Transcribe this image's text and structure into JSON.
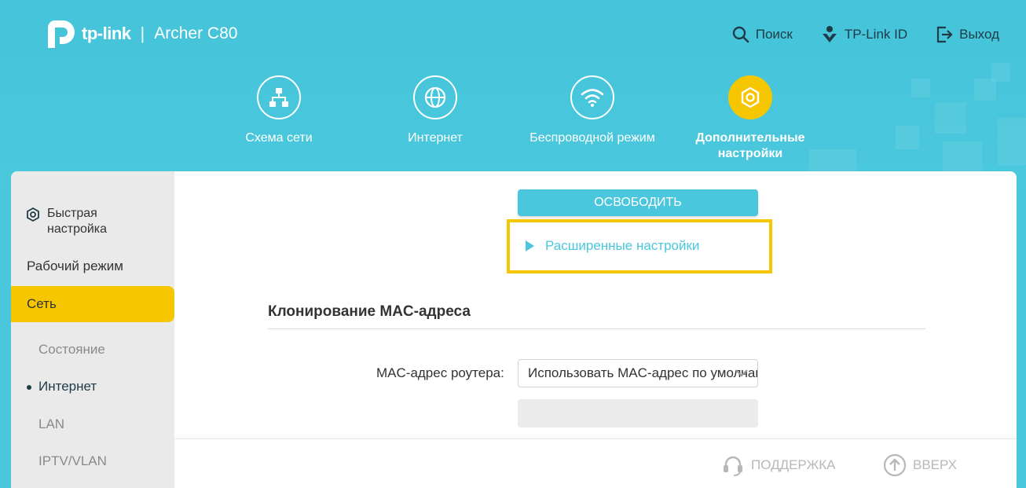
{
  "header": {
    "brand": "tp-link",
    "separator": "|",
    "model": "Archer C80",
    "links": {
      "search": "Поиск",
      "tplink_id": "TP-Link ID",
      "logout": "Выход"
    }
  },
  "nav": {
    "items": [
      {
        "label": "Схема сети",
        "icon": "network-map-icon"
      },
      {
        "label": "Интернет",
        "icon": "globe-icon"
      },
      {
        "label": "Беспроводной режим",
        "icon": "wifi-icon"
      },
      {
        "label": "Дополнительные настройки",
        "icon": "gear-icon",
        "active": true
      }
    ]
  },
  "sidebar": {
    "quick_setup": "Быстрая настройка",
    "operation_mode": "Рабочий режим",
    "network": "Сеть",
    "sub": {
      "status": "Состояние",
      "internet": "Интернет",
      "lan": "LAN",
      "iptv": "IPTV/VLAN"
    }
  },
  "main": {
    "release_button": "ОСВОБОДИТЬ",
    "advanced_link": "Расширенные настройки",
    "section_title": "Клонирование MAC-адреса",
    "mac_label": "MAC-адрес роутера:",
    "mac_select_value": "Использовать MAC-адрес по умолчанию"
  },
  "footer": {
    "support": "ПОДДЕРЖКА",
    "top": "ВВЕРХ"
  },
  "colors": {
    "header": "#4ac7dc",
    "accent": "#f6c600",
    "text_dark": "#1e3b47"
  }
}
